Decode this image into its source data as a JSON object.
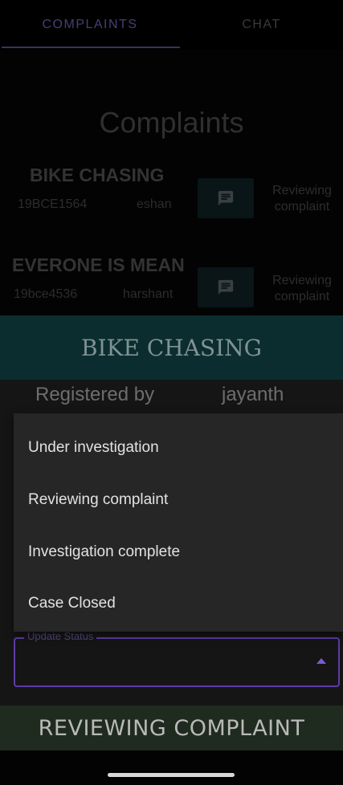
{
  "tabs": [
    {
      "label": "COMPLAINTS"
    },
    {
      "label": "CHAT"
    }
  ],
  "page_title": "Complaints",
  "complaints": [
    {
      "title": "BIKE CHASING",
      "id": "19BCE1564",
      "user": "eshan",
      "status": "Reviewing complaint"
    },
    {
      "title": "EVERONE IS MEAN",
      "id": "19bce4536",
      "user": "harshant",
      "status": "Reviewing complaint"
    }
  ],
  "dialog": {
    "title": "BIKE CHASING",
    "registered_label": "Registered by",
    "registered_name": "jayanth",
    "status_options": [
      "Under investigation",
      "Reviewing complaint",
      "Investigation complete",
      "Case Closed"
    ],
    "field_label": "Update Status",
    "action_label": "REVIEWING COMPLAINT"
  },
  "icons": {
    "chat": "chat-bubble-icon",
    "dropdown": "arrow-drop-up-icon"
  },
  "colors": {
    "accent": "#5d3ca6",
    "dialog_header": "#0c2d2f",
    "action_bar": "#1f2b1f"
  }
}
